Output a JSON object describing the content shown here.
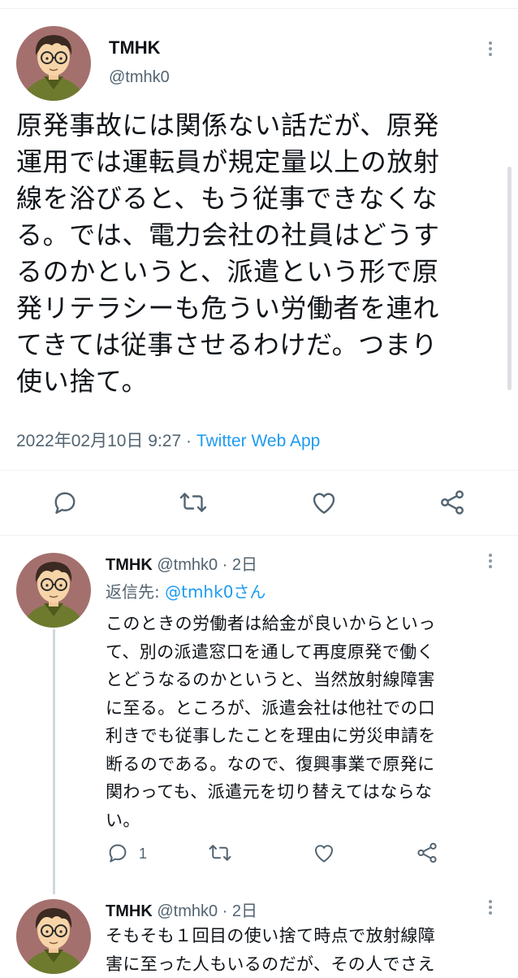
{
  "main_tweet": {
    "name": "TMHK",
    "handle": "@tmhk0",
    "text": "原発事故には関係ない話だが、原発\n運用では運転員が規定量以上の放射\n線を浴びると、もう従事できなくな\nる。では、電力会社の社員はどうす\nるのかというと、派遣という形で原\n発リテラシーも危うい労働者を連れ\nてきては従事させるわけだ。つまり\n使い捨て。",
    "timestamp": "2022年02月10日 9:27",
    "separator": " · ",
    "source": "Twitter Web App",
    "actions": [
      "reply-icon",
      "retweet-icon",
      "like-icon",
      "share-icon"
    ]
  },
  "replies": [
    {
      "name": "TMHK",
      "handle": "@tmhk0",
      "dot": "·",
      "age": "2日",
      "reply_to_label": "返信先: ",
      "reply_to_user": "@tmhk0さん",
      "text": "このときの労働者は給金が良いからといっ\nて、別の派遣窓口を通して再度原発で働く\nとどうなるのかというと、当然放射線障害\nに至る。ところが、派遣会社は他社での口\n利きでも従事したことを理由に労災申請を\n断るのである。なので、復興事業で原発に\n関わっても、派遣元を切り替えてはならな\nい。",
      "reply_count": "1"
    },
    {
      "name": "TMHK",
      "handle": "@tmhk0",
      "dot": "·",
      "age": "2日",
      "text": "そもそも１回目の使い捨て時点で放射線障\n害に至った人もいるのだが、その人でさえ"
    }
  ],
  "colors": {
    "accent": "#1d9bf0",
    "secondary_text": "#536471",
    "icon": "#536471",
    "divider": "#eff3f4",
    "thread_line": "#cfd9de"
  }
}
